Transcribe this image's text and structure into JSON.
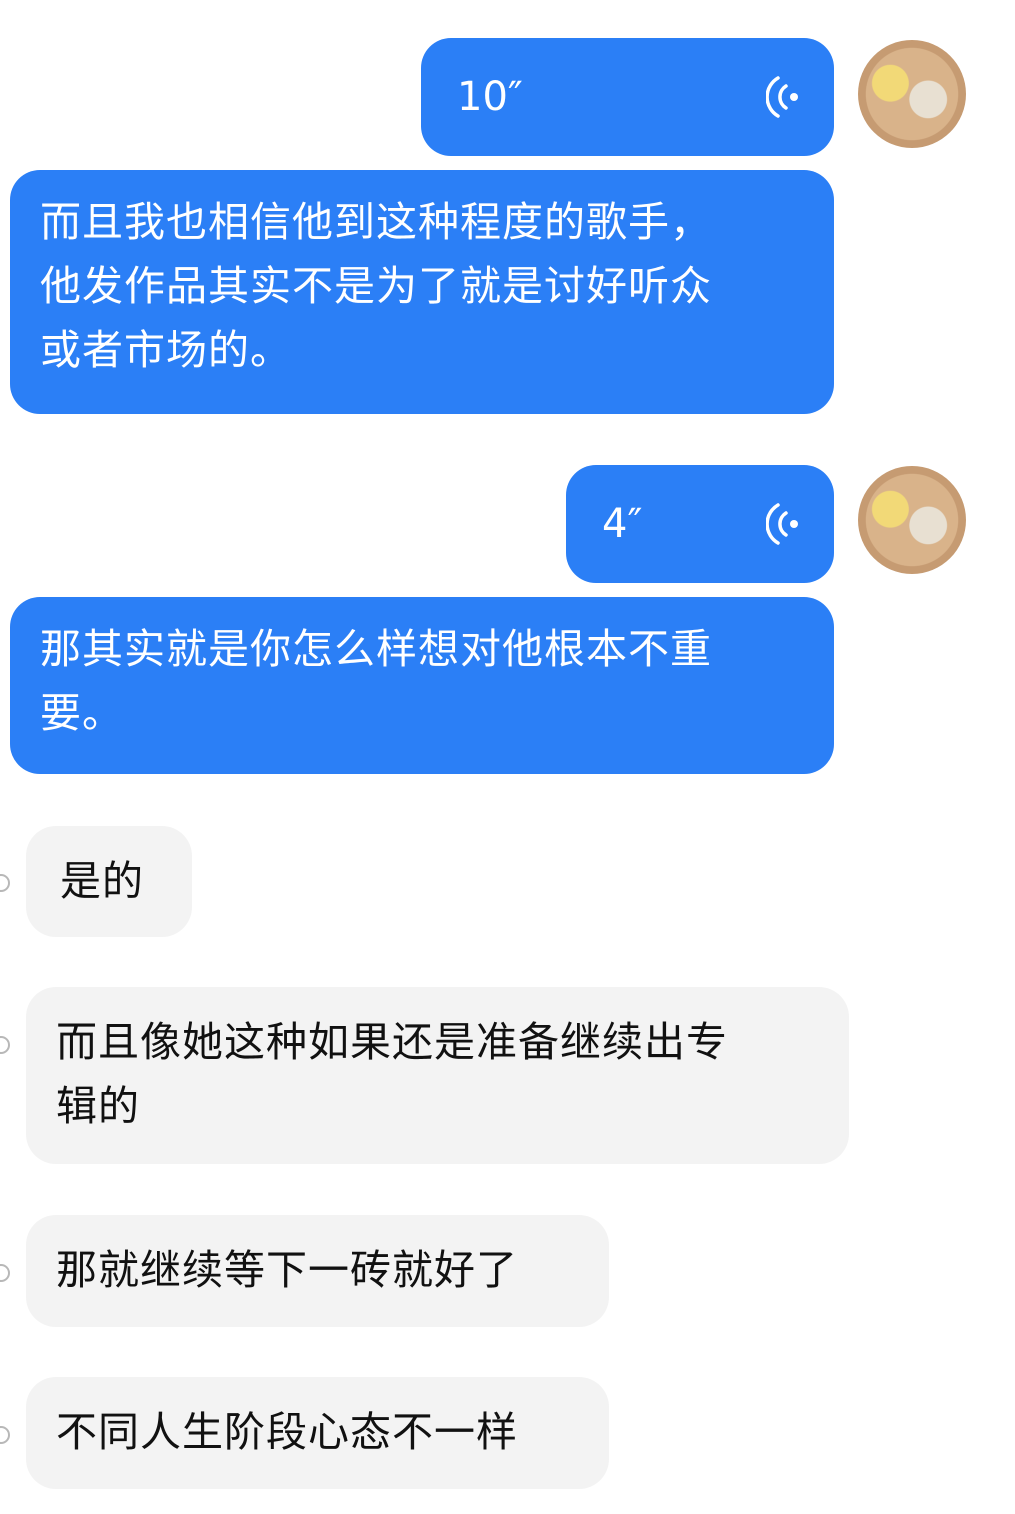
{
  "messages": {
    "voice1": {
      "duration": "10″"
    },
    "text1": {
      "lines": [
        "而且我也相信他到这种程度的歌手，",
        "他发作品其实不是为了就是讨好听众",
        "或者市场的。"
      ]
    },
    "voice2": {
      "duration": "4″"
    },
    "text2": {
      "lines": [
        "那其实就是你怎么样想对他根本不重",
        "要。"
      ]
    },
    "reply1": {
      "lines": [
        "是的"
      ]
    },
    "reply2": {
      "lines": [
        "而且像她这种如果还是准备继续出专",
        "辑的"
      ]
    },
    "reply3": {
      "lines": [
        "那就继续等下一砖就好了"
      ]
    },
    "reply4": {
      "lines": [
        "不同人生阶段心态不一样"
      ]
    }
  },
  "colors": {
    "outgoing": "#2b7ff6",
    "incoming": "#f3f3f3"
  },
  "icons": {
    "voice": "sound-wave-icon",
    "avatar": "user-avatar"
  }
}
